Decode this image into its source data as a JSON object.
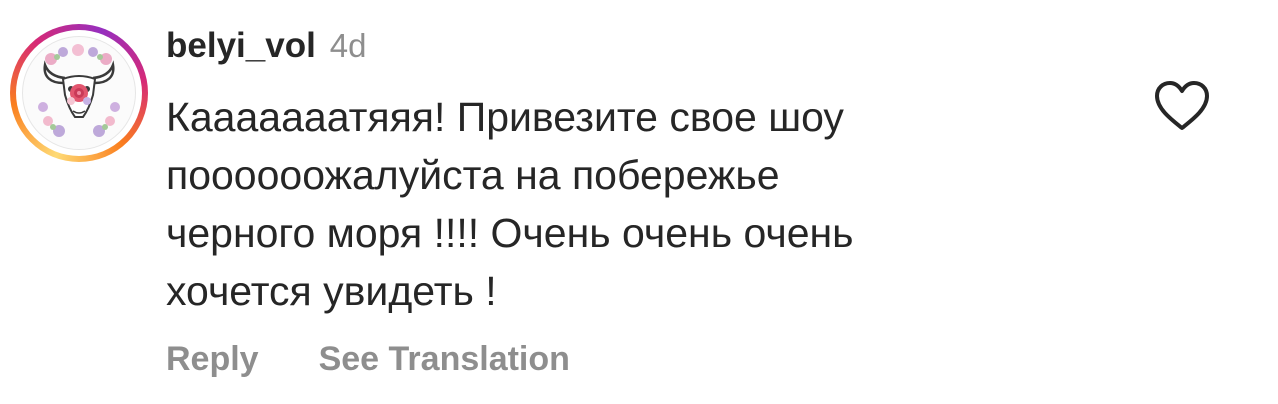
{
  "comment": {
    "username": "belyi_vol",
    "time": "4d",
    "text": "Кааааааатяяя! Привезите свое шоу\nпоооооожалуйста на побережье\nчерного моря !!!! Очень очень очень\nхочется увидеть !",
    "actions": {
      "reply": "Reply",
      "translate": "See Translation"
    },
    "like_icon": "heart-outline-icon",
    "avatar_icon": "bull-skull-with-flowers-icon"
  },
  "colors": {
    "text": "#262626",
    "secondary": "#8e8e8e",
    "icon": "#262626",
    "story_ring": [
      "#feda75",
      "#fa7e1e",
      "#d62976",
      "#962fbf"
    ]
  }
}
